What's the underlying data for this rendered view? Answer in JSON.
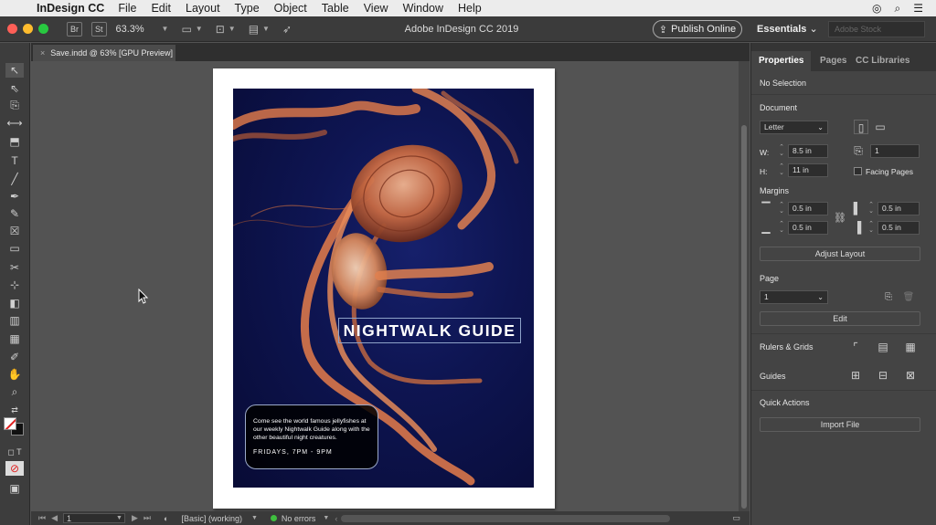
{
  "menubar": {
    "app_name": "InDesign CC",
    "items": [
      "File",
      "Edit",
      "Layout",
      "Type",
      "Object",
      "Table",
      "View",
      "Window",
      "Help"
    ]
  },
  "appbar": {
    "chip_br": "Br",
    "chip_st": "St",
    "zoom": "63.3%",
    "title": "Adobe InDesign CC 2019",
    "publish_label": "Publish Online",
    "workspace": "Essentials",
    "stock_placeholder": "Adobe Stock"
  },
  "doc_tab": {
    "label": "Save.indd @ 63% [GPU Preview]",
    "close": "×"
  },
  "document": {
    "headline": "NIGHTWALK GUIDE",
    "body": "Come see the world famous jellyfishes at our weekly Nightwalk Guide along with the other beautiful night creatures.",
    "time": "FRIDAYS, 7PM - 9PM"
  },
  "statusbar": {
    "page": "1",
    "preflight_profile": "[Basic] (working)",
    "errors": "No errors"
  },
  "panel": {
    "tabs": [
      "Properties",
      "Pages",
      "CC Libraries"
    ],
    "selection": "No Selection",
    "document_label": "Document",
    "page_size": "Letter",
    "w_label": "W:",
    "h_label": "H:",
    "width": "8.5 in",
    "height": "11 in",
    "pages_count": "1",
    "facing_pages": "Facing Pages",
    "margins_label": "Margins",
    "margin_top": "0.5 in",
    "margin_bottom": "0.5 in",
    "margin_left": "0.5 in",
    "margin_right": "0.5 in",
    "adjust_layout": "Adjust Layout",
    "page_label": "Page",
    "page_value": "1",
    "edit": "Edit",
    "rulers_grids": "Rulers & Grids",
    "guides": "Guides",
    "quick_actions": "Quick Actions",
    "import_file": "Import File"
  },
  "colors": {
    "accent_green": "#3fbf3f",
    "traffic_close": "#fe5f57",
    "traffic_min": "#febc2e",
    "traffic_max": "#28c840",
    "poster_bg": "#0e1552",
    "jelly": "#e2794a"
  }
}
